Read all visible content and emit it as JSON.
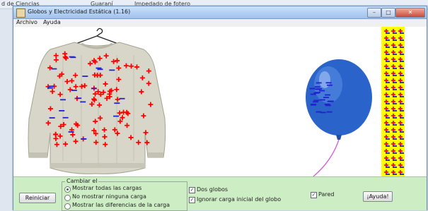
{
  "taskbar": {
    "item1": "d de Ciencias",
    "item2": "Guaraní",
    "item3": "Impedado de fotero"
  },
  "window": {
    "title": "Globos y Electricidad Estática (1.16)"
  },
  "menu": {
    "archivo": "Archivo",
    "ayuda": "Ayuda"
  },
  "controls": {
    "reset_label": "Reiniciar",
    "group_title": "Cambiar el",
    "radio_all": "Mostrar todas las cargas",
    "radio_none": "No mostrar ninguna carga",
    "radio_diff": "Mostrar las diferencias de la carga",
    "radio_selected": "all",
    "check_two_balloons": "Dos globos",
    "check_ignore_initial": "Ignorar carga inicial del globo",
    "check_wall": "Pared",
    "help_label": "¡Ayuda!",
    "two_balloons_checked": true,
    "ignore_initial_checked": true,
    "wall_checked": true
  },
  "colors": {
    "positive": "#ff0000",
    "negative": "#2222cc",
    "wall": "#ffff00",
    "control_panel": "#cdeec4",
    "balloon": "#2a63c9"
  }
}
